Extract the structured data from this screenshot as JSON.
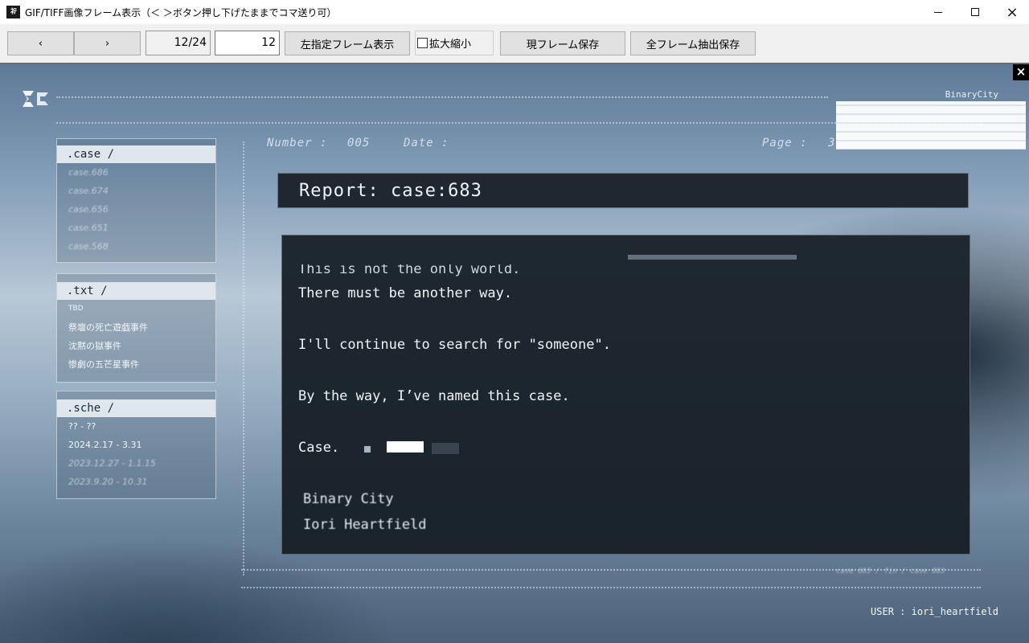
{
  "window": {
    "title": "GIF/TIFF画像フレーム表示（＜ ＞ボタン押し下げたままでコマ送り可）",
    "icon_text": "ﾈﾃ",
    "controls": {
      "minimize": "minimize-icon",
      "maximize": "maximize-icon",
      "close": "×"
    }
  },
  "toolbar": {
    "prev_label": "‹",
    "next_label": "›",
    "frame_counter": "12/24",
    "frame_input": "12",
    "show_frame_label": "左指定フレーム表示",
    "zoom_label": "拡大縮小",
    "zoom_checked": false,
    "save_current_label": "現フレーム保存",
    "save_all_label": "全フレーム抽出保存"
  },
  "image": {
    "close_label": "×",
    "brand": "BinaryCity",
    "meta": {
      "number_label": "Number :",
      "number_value": "005",
      "date_label": "Date :",
      "page_label": "Page :",
      "page_value": "3"
    },
    "panels": {
      "case": {
        "header": ".case /",
        "items": [
          "case.686",
          "case.674",
          "case.656",
          "case.651",
          "case.568"
        ]
      },
      "txt": {
        "header": ".txt /",
        "items": [
          "TBD",
          "祭壇の死亡遊戯事件",
          "沈黙の獄事件",
          "惨劇の五芒星事件"
        ]
      },
      "sche": {
        "header": ".sche /",
        "items": [
          "?? - ??",
          "2024.2.17 - 3.31",
          "2023.12.27 - 1.1.15",
          "2023.9.20 - 10.31"
        ]
      }
    },
    "report_title": "Report: case:683",
    "body_lines": [
      "This is not the only world.",
      "There must be another way.",
      "I'll continue to search for \"someone\".",
      "By the way, I’ve named this case.",
      "Case."
    ],
    "signature": [
      "Binary City",
      "Iori Heartfield"
    ],
    "footer_note": "case 683 / fin / case 683",
    "user_label": "USER : iori_heartfield"
  }
}
